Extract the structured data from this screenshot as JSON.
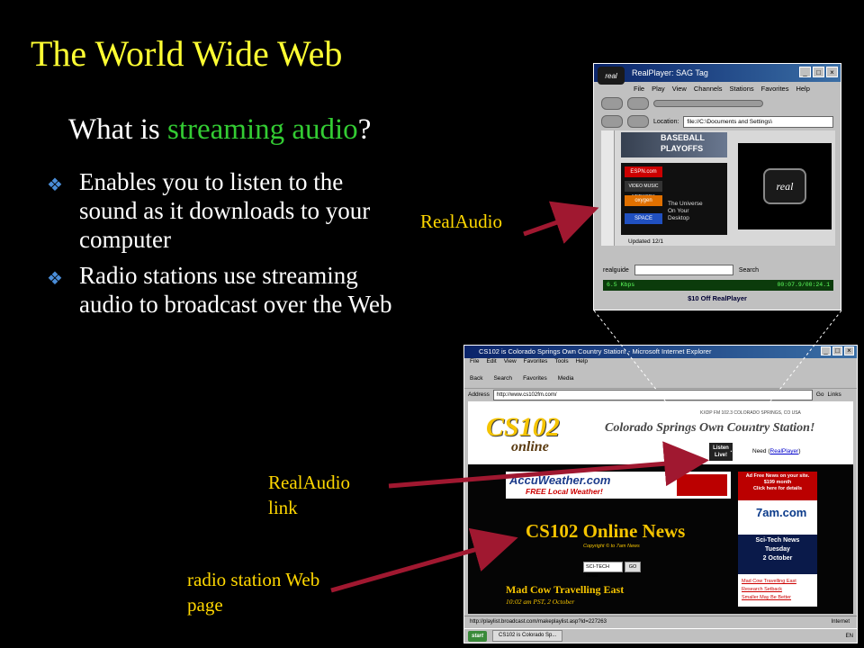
{
  "slide": {
    "title": "The World Wide Web",
    "subtitle_pre": "What is ",
    "subtitle_highlight": "streaming audio",
    "subtitle_post": "?",
    "bullets": [
      "Enables you to listen to the sound as it downloads to your computer",
      "Radio stations use streaming audio to broadcast over the Web"
    ],
    "callouts": {
      "realaudio": "RealAudio",
      "realaudio_link_1": "RealAudio",
      "realaudio_link_2": "link",
      "station_page_1": "radio station Web",
      "station_page_2": "page"
    }
  },
  "colors": {
    "background": "#000000",
    "title": "#ffff33",
    "highlight": "#33cc33",
    "callout": "#ffd700",
    "arrow": "#a01830"
  },
  "realplayer": {
    "window_title": "RealPlayer: SAG Tag",
    "logo": "real",
    "menu": [
      "File",
      "Play",
      "View",
      "Channels",
      "Stations",
      "Favorites",
      "Help"
    ],
    "location_label": "Location:",
    "location_value": "file://C:\\Documents and Settings\\",
    "banner_1": "BASEBALL",
    "banner_2": "PLAYOFFS",
    "channels": [
      "ESPN.com",
      "VIDEO MUSIC NETWORK",
      "oxygen",
      "SPACE"
    ],
    "channel_desc_1": "The Universe",
    "channel_desc_2": "On Your",
    "channel_desc_3": "Desktop",
    "updated": "Updated 12/1",
    "guide": "realguide",
    "search_label": "Search",
    "status_rate": "6.5 Kbps",
    "status_time": "00:07.9/00:24.1",
    "promo": "$10 Off RealPlayer"
  },
  "ie": {
    "window_title": "CS102 is Colorado Springs Own Country Station! - Microsoft Internet Explorer",
    "menu": [
      "File",
      "Edit",
      "View",
      "Favorites",
      "Tools",
      "Help"
    ],
    "toolbar": [
      "Back",
      "Search",
      "Favorites",
      "Media"
    ],
    "address_label": "Address",
    "address_value": "http://www.cs102fm.com/",
    "go_label": "Go",
    "links_label": "Links",
    "status": "http://playlist.broadcast.com/makeplaylist.asp?id=227263",
    "zone": "Internet",
    "start": "start",
    "task": "CS102 is Colorado Sp...",
    "tray": "EN"
  },
  "website": {
    "logo": "CS102",
    "logo_sub": "online",
    "tagline": "Colorado Springs Own Country Station!",
    "address": "KXDP FM 102.3 COLORADO SPRINGS, CO USA",
    "listen_1": "Listen",
    "listen_2": "Live!",
    "need_pre": "Need",
    "need_link": "RealPlayer",
    "accu_logo": "AccuWeather.com",
    "accu_sub": "FREE Local Weather!",
    "ad_1": "Ad Free News on your site.",
    "ad_2": "$199 month",
    "ad_3": "Click here for details",
    "ad_7am": "7am.com",
    "sci_1": "Sci-Tech News",
    "sci_2": "Tuesday",
    "sci_3": "2 October",
    "side_links": [
      "Mad Cow Travelling East",
      "Research Setback",
      "Smaller May Be Better"
    ],
    "news_title": "CS102 Online News",
    "copyright": "Copyright © to 7am News",
    "select_value": "SCI-TECH News",
    "go": "GO",
    "headline": "Mad Cow Travelling East",
    "byline": "10:02 am PST, 2 October"
  }
}
